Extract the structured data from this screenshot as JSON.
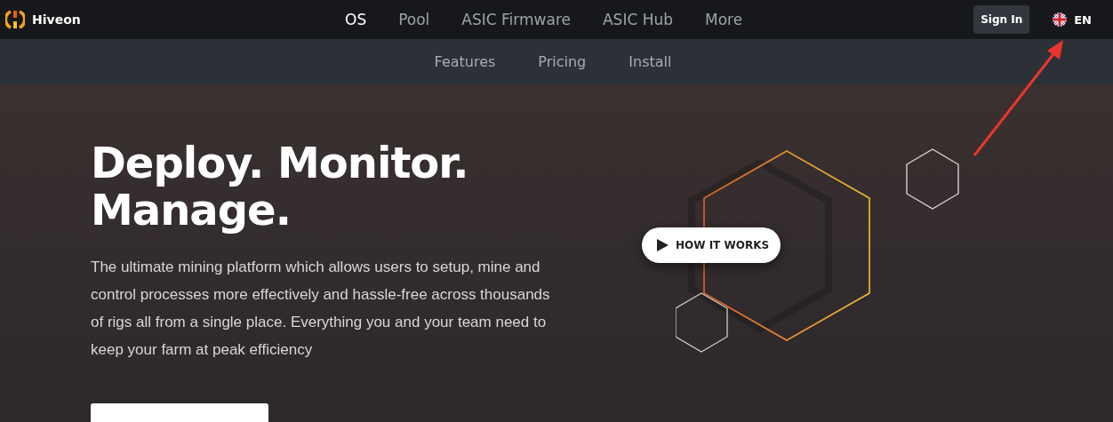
{
  "brand": {
    "name": "Hiveon"
  },
  "nav": [
    {
      "label": "OS",
      "selected": true
    },
    {
      "label": "Pool",
      "selected": false
    },
    {
      "label": "ASIC Firmware",
      "selected": false
    },
    {
      "label": "ASIC Hub",
      "selected": false
    },
    {
      "label": "More",
      "selected": false
    }
  ],
  "sign_in": "Sign In",
  "language": "EN",
  "subnav": [
    "Features",
    "Pricing",
    "Install"
  ],
  "hero": {
    "title_lines": [
      "Deploy. Monitor.",
      "Manage."
    ],
    "description": "The ultimate mining platform which allows users to setup, mine and control processes more effectively and hassle-free across thousands of rigs all from a single place. Everything you and your team need to keep your farm at peak efficiency",
    "video_button": "HOW IT WORKS"
  }
}
